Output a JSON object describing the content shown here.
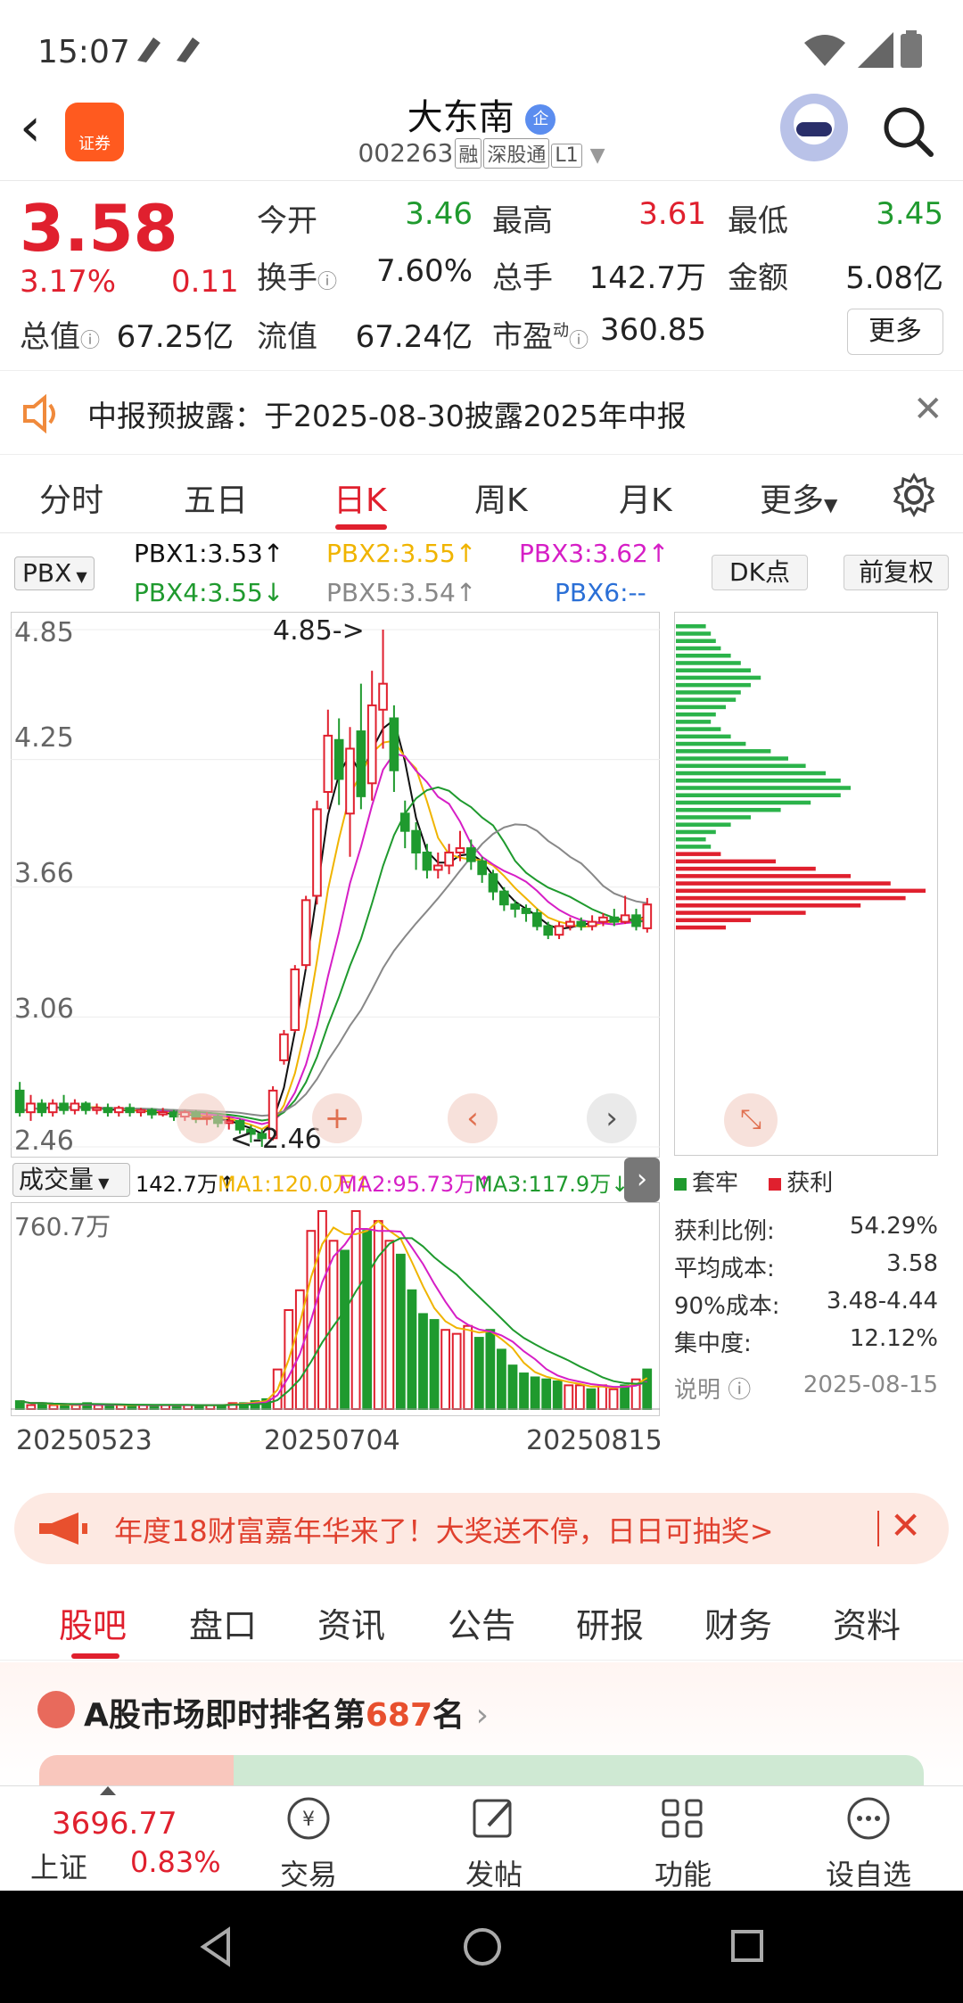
{
  "status_bar": {
    "time": "15:07"
  },
  "header": {
    "back_icon": "back-arrow-icon",
    "logo_text": "证券",
    "stock_name": "大东南",
    "stock_badge": "企",
    "stock_code": "002263",
    "tags": [
      "融",
      "深股通",
      "L1"
    ]
  },
  "quote": {
    "price": "3.58",
    "change_pct": "3.17%",
    "change": "0.11",
    "open_label": "今开",
    "open": "3.46",
    "high_label": "最高",
    "high": "3.61",
    "low_label": "最低",
    "low": "3.45",
    "turnover_label": "换手",
    "turnover": "7.60%",
    "volume_label": "总手",
    "volume": "142.7万",
    "amount_label": "金额",
    "amount": "5.08亿",
    "mktcap_label": "总值",
    "mktcap": "67.25亿",
    "float_label": "流值",
    "float": "67.24亿",
    "pe_label": "市盈",
    "pe_sup": "动",
    "pe": "360.85",
    "more": "更多"
  },
  "notice": {
    "text": "中报预披露：于2025-08-30披露2025年中报"
  },
  "period_tabs": [
    "分时",
    "五日",
    "日K",
    "周K",
    "月K",
    "更多"
  ],
  "period_active": "日K",
  "chart_header": {
    "indicator": "PBX",
    "pbx1": "PBX1:3.53↑",
    "pbx2": "PBX2:3.55↑",
    "pbx3": "PBX3:3.62↑",
    "pbx4": "PBX4:3.55↓",
    "pbx5": "PBX5:3.54↑",
    "pbx6": "PBX6:--",
    "dk": "DK点",
    "adjust": "前复权"
  },
  "price_axis": [
    "4.85",
    "4.25",
    "3.66",
    "3.06",
    "2.46"
  ],
  "annotations": {
    "high": "4.85->",
    "low": "<-2.46"
  },
  "volume_header": {
    "selector": "成交量",
    "vol": "142.7万↑",
    "ma1": "MA1:120.0万↑",
    "ma2": "MA2:95.73万↑",
    "ma3": "MA3:117.9万↓",
    "max": "760.7万"
  },
  "dates": [
    "20250523",
    "20250704",
    "20250815"
  ],
  "chips": {
    "legend_loss": "套牢",
    "legend_profit": "获利",
    "rows": [
      {
        "label": "获利比例:",
        "value": "54.29%"
      },
      {
        "label": "平均成本:",
        "value": "3.58"
      },
      {
        "label": "90%成本:",
        "value": "3.48-4.44"
      },
      {
        "label": "集中度:",
        "value": "12.12%"
      }
    ],
    "note_label": "说明",
    "note_date": "2025-08-15"
  },
  "colors": {
    "up": "#e0202e",
    "down": "#1f9a2e",
    "ma_black": "#111111",
    "ma_yellow": "#f0b400",
    "ma_magenta": "#d61fc6",
    "ma_green": "#1f9a2e",
    "ma_gray": "#888888"
  },
  "candles": [
    {
      "o": 2.72,
      "c": 2.62,
      "h": 2.76,
      "l": 2.6
    },
    {
      "o": 2.62,
      "c": 2.66,
      "h": 2.7,
      "l": 2.58
    },
    {
      "o": 2.66,
      "c": 2.62,
      "h": 2.68,
      "l": 2.6
    },
    {
      "o": 2.62,
      "c": 2.66,
      "h": 2.68,
      "l": 2.6
    },
    {
      "o": 2.66,
      "c": 2.63,
      "h": 2.7,
      "l": 2.61
    },
    {
      "o": 2.63,
      "c": 2.66,
      "h": 2.68,
      "l": 2.61
    },
    {
      "o": 2.66,
      "c": 2.63,
      "h": 2.67,
      "l": 2.61
    },
    {
      "o": 2.63,
      "c": 2.64,
      "h": 2.66,
      "l": 2.61
    },
    {
      "o": 2.64,
      "c": 2.62,
      "h": 2.66,
      "l": 2.6
    },
    {
      "o": 2.62,
      "c": 2.64,
      "h": 2.65,
      "l": 2.6
    },
    {
      "o": 2.64,
      "c": 2.62,
      "h": 2.66,
      "l": 2.6
    },
    {
      "o": 2.62,
      "c": 2.63,
      "h": 2.64,
      "l": 2.6
    },
    {
      "o": 2.63,
      "c": 2.61,
      "h": 2.64,
      "l": 2.59
    },
    {
      "o": 2.61,
      "c": 2.62,
      "h": 2.64,
      "l": 2.6
    },
    {
      "o": 2.62,
      "c": 2.6,
      "h": 2.63,
      "l": 2.58
    },
    {
      "o": 2.6,
      "c": 2.62,
      "h": 2.63,
      "l": 2.58
    },
    {
      "o": 2.62,
      "c": 2.59,
      "h": 2.63,
      "l": 2.57
    },
    {
      "o": 2.59,
      "c": 2.6,
      "h": 2.62,
      "l": 2.56
    },
    {
      "o": 2.6,
      "c": 2.57,
      "h": 2.61,
      "l": 2.55
    },
    {
      "o": 2.57,
      "c": 2.58,
      "h": 2.6,
      "l": 2.54
    },
    {
      "o": 2.58,
      "c": 2.54,
      "h": 2.59,
      "l": 2.52
    },
    {
      "o": 2.54,
      "c": 2.52,
      "h": 2.56,
      "l": 2.48
    },
    {
      "o": 2.52,
      "c": 2.5,
      "h": 2.54,
      "l": 2.46
    },
    {
      "o": 2.5,
      "c": 2.72,
      "h": 2.74,
      "l": 2.49
    },
    {
      "o": 2.86,
      "c": 2.98,
      "h": 3.0,
      "l": 2.84
    },
    {
      "o": 3.0,
      "c": 3.28,
      "h": 3.3,
      "l": 2.99
    },
    {
      "o": 3.3,
      "c": 3.6,
      "h": 3.62,
      "l": 3.28
    },
    {
      "o": 3.62,
      "c": 4.02,
      "h": 4.06,
      "l": 3.58
    },
    {
      "o": 4.1,
      "c": 4.36,
      "h": 4.48,
      "l": 4.02
    },
    {
      "o": 4.34,
      "c": 4.16,
      "h": 4.44,
      "l": 4.04
    },
    {
      "o": 4.0,
      "c": 4.3,
      "h": 4.4,
      "l": 3.8
    },
    {
      "o": 4.38,
      "c": 4.08,
      "h": 4.6,
      "l": 4.02
    },
    {
      "o": 4.14,
      "c": 4.5,
      "h": 4.66,
      "l": 4.06
    },
    {
      "o": 4.48,
      "c": 4.6,
      "h": 4.85,
      "l": 4.3
    },
    {
      "o": 4.44,
      "c": 4.2,
      "h": 4.5,
      "l": 4.1
    },
    {
      "o": 4.0,
      "c": 3.92,
      "h": 4.06,
      "l": 3.84
    },
    {
      "o": 3.92,
      "c": 3.82,
      "h": 3.96,
      "l": 3.74
    },
    {
      "o": 3.82,
      "c": 3.74,
      "h": 3.86,
      "l": 3.7
    },
    {
      "o": 3.74,
      "c": 3.76,
      "h": 3.82,
      "l": 3.7
    },
    {
      "o": 3.76,
      "c": 3.82,
      "h": 3.86,
      "l": 3.72
    },
    {
      "o": 3.82,
      "c": 3.84,
      "h": 3.92,
      "l": 3.78
    },
    {
      "o": 3.84,
      "c": 3.78,
      "h": 3.88,
      "l": 3.74
    },
    {
      "o": 3.78,
      "c": 3.72,
      "h": 3.8,
      "l": 3.68
    },
    {
      "o": 3.72,
      "c": 3.64,
      "h": 3.74,
      "l": 3.6
    },
    {
      "o": 3.64,
      "c": 3.58,
      "h": 3.66,
      "l": 3.55
    },
    {
      "o": 3.58,
      "c": 3.56,
      "h": 3.6,
      "l": 3.52
    },
    {
      "o": 3.56,
      "c": 3.54,
      "h": 3.58,
      "l": 3.5
    },
    {
      "o": 3.54,
      "c": 3.48,
      "h": 3.56,
      "l": 3.46
    },
    {
      "o": 3.48,
      "c": 3.44,
      "h": 3.5,
      "l": 3.42
    },
    {
      "o": 3.44,
      "c": 3.48,
      "h": 3.5,
      "l": 3.42
    },
    {
      "o": 3.48,
      "c": 3.5,
      "h": 3.52,
      "l": 3.46
    },
    {
      "o": 3.5,
      "c": 3.48,
      "h": 3.52,
      "l": 3.46
    },
    {
      "o": 3.48,
      "c": 3.5,
      "h": 3.53,
      "l": 3.46
    },
    {
      "o": 3.5,
      "c": 3.52,
      "h": 3.54,
      "l": 3.48
    },
    {
      "o": 3.52,
      "c": 3.5,
      "h": 3.56,
      "l": 3.48
    },
    {
      "o": 3.5,
      "c": 3.53,
      "h": 3.62,
      "l": 3.49
    },
    {
      "o": 3.53,
      "c": 3.48,
      "h": 3.56,
      "l": 3.46
    },
    {
      "o": 3.47,
      "c": 3.58,
      "h": 3.61,
      "l": 3.45
    }
  ],
  "volumes": [
    0.04,
    0.02,
    0.03,
    0.02,
    0.02,
    0.02,
    0.03,
    0.02,
    0.02,
    0.02,
    0.02,
    0.02,
    0.02,
    0.02,
    0.02,
    0.02,
    0.02,
    0.02,
    0.02,
    0.03,
    0.03,
    0.04,
    0.05,
    0.2,
    0.5,
    0.6,
    0.9,
    1.0,
    0.85,
    0.8,
    1.0,
    0.9,
    0.95,
    0.85,
    0.78,
    0.6,
    0.48,
    0.45,
    0.4,
    0.38,
    0.42,
    0.36,
    0.4,
    0.3,
    0.22,
    0.18,
    0.16,
    0.15,
    0.14,
    0.12,
    0.12,
    0.1,
    0.12,
    0.1,
    0.12,
    0.15,
    0.2
  ],
  "chip_bars": [
    0.12,
    0.14,
    0.16,
    0.18,
    0.22,
    0.26,
    0.3,
    0.34,
    0.3,
    0.26,
    0.24,
    0.2,
    0.16,
    0.14,
    0.18,
    0.22,
    0.28,
    0.38,
    0.45,
    0.52,
    0.6,
    0.66,
    0.7,
    0.66,
    0.54,
    0.42,
    0.3,
    0.22,
    0.16,
    0.12,
    0.14,
    0.18,
    0.4,
    0.56,
    0.7,
    0.86,
    1.0,
    0.92,
    0.74,
    0.52,
    0.3,
    0.2
  ],
  "promo": {
    "text": "年度18财富嘉年华来了！大奖送不停，日日可抽奖>"
  },
  "bottom_tabs": [
    "股吧",
    "盘口",
    "资讯",
    "公告",
    "研报",
    "财务",
    "资料"
  ],
  "bottom_tab_active": "股吧",
  "rank": {
    "prefix": "A股市场即时排名第",
    "num": "687",
    "suffix": "名"
  },
  "bottom_nav": {
    "index_value": "3696.77",
    "index_name": "上证",
    "index_pct": "0.83%",
    "items": [
      "交易",
      "发帖",
      "功能",
      "设自选"
    ]
  }
}
